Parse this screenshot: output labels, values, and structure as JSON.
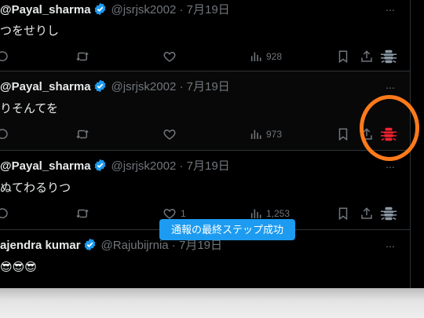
{
  "posts": [
    {
      "name": "@Payal_sharma",
      "handle": "@jsrjsk2002 · 7月19日",
      "text": "つをせりし",
      "views": "928",
      "likes": ""
    },
    {
      "name": "@Payal_sharma",
      "handle": "@jsrjsk2002 · 7月19日",
      "text": "りそんてを",
      "views": "973",
      "likes": ""
    },
    {
      "name": "@Payal_sharma",
      "handle": "@jsrjsk2002 · 7月19日",
      "text": "ぬてわるりつ",
      "views": "1,253",
      "likes": "1"
    },
    {
      "name": "ajendra kumar",
      "handle": "@Rajubijrnia · 7月19日",
      "text": "😎😎😎",
      "views": "",
      "likes": ""
    }
  ],
  "more_label": "...",
  "toast": {
    "text": "通報の最終ステップ成功"
  },
  "colors": {
    "accent": "#1d9bf0",
    "highlight_circle": "#ff7a1a",
    "bug_active": "#f4212e",
    "bug_default": "#8b98a5"
  },
  "icons": [
    "reply-icon",
    "retweet-icon",
    "like-icon",
    "views-icon",
    "bookmark-icon",
    "share-icon",
    "report-bug-icon",
    "verified-badge-icon",
    "more-icon"
  ]
}
